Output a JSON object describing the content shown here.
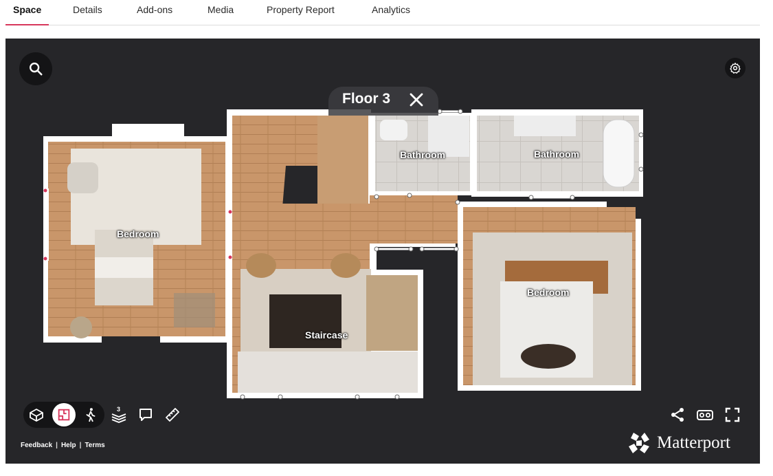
{
  "tabs": [
    {
      "label": "Space",
      "active": true
    },
    {
      "label": "Details",
      "active": false
    },
    {
      "label": "Add-ons",
      "active": false
    },
    {
      "label": "Media",
      "active": false
    },
    {
      "label": "Property Report",
      "active": false
    },
    {
      "label": "Analytics",
      "active": false
    }
  ],
  "viewer": {
    "floor_title": "Floor 3",
    "floor_count_badge": "3",
    "rooms": [
      {
        "label": "Bedroom"
      },
      {
        "label": "Staircase"
      },
      {
        "label": "Bathroom"
      },
      {
        "label": "Bathroom"
      },
      {
        "label": "Bedroom"
      }
    ],
    "top_icons": [
      "search-icon",
      "settings-icon"
    ],
    "toolbar_icons": [
      "dollhouse-icon",
      "floorplan-icon",
      "walkthrough-icon",
      "floors-icon",
      "comment-icon",
      "measure-icon"
    ],
    "right_icons": [
      "share-icon",
      "vr-icon",
      "fullscreen-icon"
    ],
    "footer": {
      "feedback": "Feedback",
      "help": "Help",
      "terms": "Terms",
      "separator": "|"
    },
    "brand": "Matterport",
    "colors": {
      "accent": "#d7365b",
      "viewer_bg": "#262629",
      "control_bg": "#141416",
      "wood": "#c9966a",
      "wall": "#ffffff"
    }
  }
}
